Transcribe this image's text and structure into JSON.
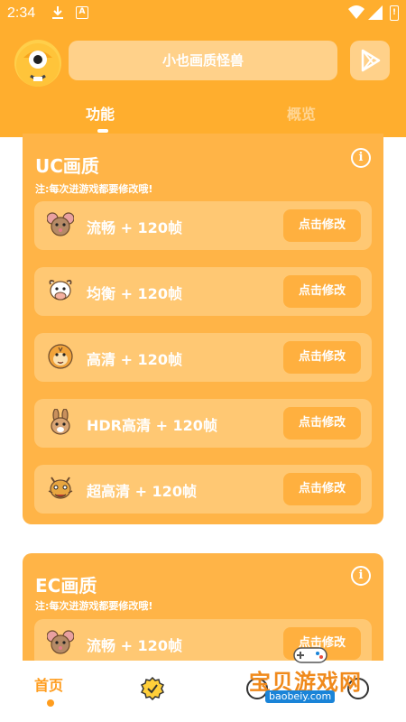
{
  "status_bar": {
    "time": "2:34",
    "app_badge": "A"
  },
  "header": {
    "search_text": "小也画质怪兽",
    "tabs": [
      {
        "label": "功能",
        "active": true
      },
      {
        "label": "概览",
        "active": false
      }
    ]
  },
  "colors": {
    "primary": "#ffae2e",
    "card": "#ffb447",
    "row": "#ffc873",
    "button": "#ffb03f",
    "nav_active": "#ff9d1e"
  },
  "sections": [
    {
      "title": "UC画质",
      "note": "注:每次进游戏都要修改哦!",
      "info_icon": "info-icon",
      "rows": [
        {
          "icon": "mouse-icon",
          "label": "流畅 + 120帧",
          "button": "点击修改"
        },
        {
          "icon": "cow-icon",
          "label": "均衡 + 120帧",
          "button": "点击修改"
        },
        {
          "icon": "tiger-icon",
          "label": "高清 + 120帧",
          "button": "点击修改"
        },
        {
          "icon": "rabbit-icon",
          "label": "HDR高清 + 120帧",
          "button": "点击修改"
        },
        {
          "icon": "dragon-icon",
          "label": "超高清 + 120帧",
          "button": "点击修改"
        }
      ]
    },
    {
      "title": "EC画质",
      "note": "注:每次进游戏都要修改哦!",
      "info_icon": "info-icon",
      "rows": [
        {
          "icon": "mouse-icon",
          "label": "流畅 + 120帧",
          "button": "点击修改"
        }
      ]
    }
  ],
  "bottom_nav": {
    "items": [
      {
        "label": "首页",
        "icon": "home-text",
        "active": true
      },
      {
        "label": "",
        "icon": "badge-check-icon",
        "active": false
      },
      {
        "label": "",
        "icon": "circle-icon",
        "active": false
      },
      {
        "label": "",
        "icon": "circle-icon",
        "active": false
      }
    ]
  },
  "watermark": {
    "title": "宝贝游戏网",
    "url": "baobeiy.com"
  }
}
